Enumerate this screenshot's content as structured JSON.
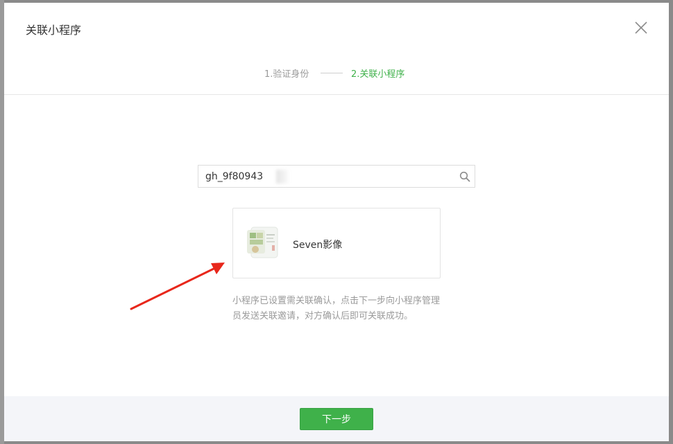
{
  "dialog": {
    "title": "关联小程序",
    "close_icon": "close-icon"
  },
  "steps": [
    {
      "label": "1.验证身份",
      "state": "done"
    },
    {
      "label": "2.关联小程序",
      "state": "active"
    }
  ],
  "search": {
    "value": "gh_9f80943",
    "icon": "search-icon"
  },
  "result": {
    "name": "Seven影像",
    "avatar_icon": "mini-program-thumbnail"
  },
  "tip": "小程序已设置需关联确认，点击下一步向小程序管理员发送关联邀请，对方确认后即可关联成功。",
  "footer": {
    "next_label": "下一步"
  },
  "colors": {
    "accent": "#3fb14a",
    "annotation_arrow": "#e8271b"
  }
}
